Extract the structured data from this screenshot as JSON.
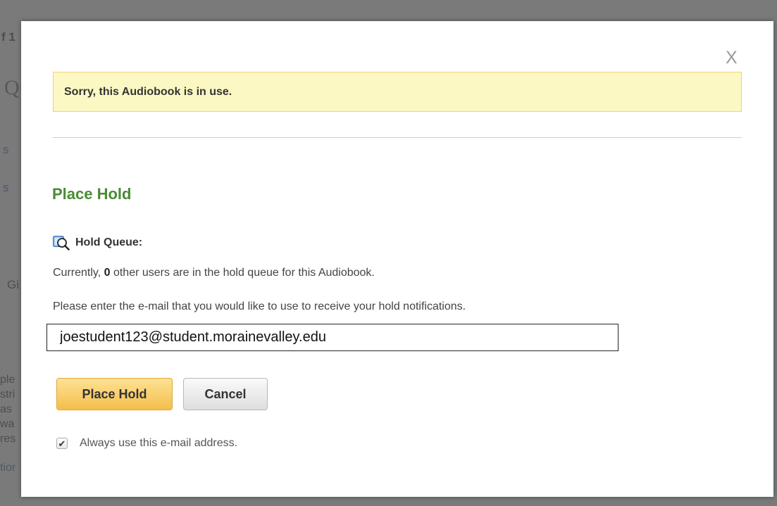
{
  "background": {
    "fragments": [
      "f 1",
      "Q",
      "s",
      "s",
      "Gi",
      "ple",
      "stri",
      "as",
      "wa",
      "res",
      "tior"
    ]
  },
  "modal": {
    "close_label": "X",
    "alert_message": "Sorry, this Audiobook is in use.",
    "heading": "Place Hold",
    "hold_queue_label": "Hold Queue:",
    "queue_icon": "magnifier-icon",
    "queue_text_before": "Currently, ",
    "queue_count": "0",
    "queue_text_after": " other users are in the hold queue for this Audiobook.",
    "email_prompt": "Please enter the e-mail that you would like to use to receive your hold notifications.",
    "email_value": "joestudent123@student.morainevalley.edu",
    "place_hold_button": "Place Hold",
    "cancel_button": "Cancel",
    "always_use_label": "Always use this e-mail address.",
    "always_use_checked": true
  },
  "colors": {
    "heading_green": "#4a8b33",
    "alert_bg": "#fcf8c4",
    "primary_button": "#f4be4a"
  }
}
